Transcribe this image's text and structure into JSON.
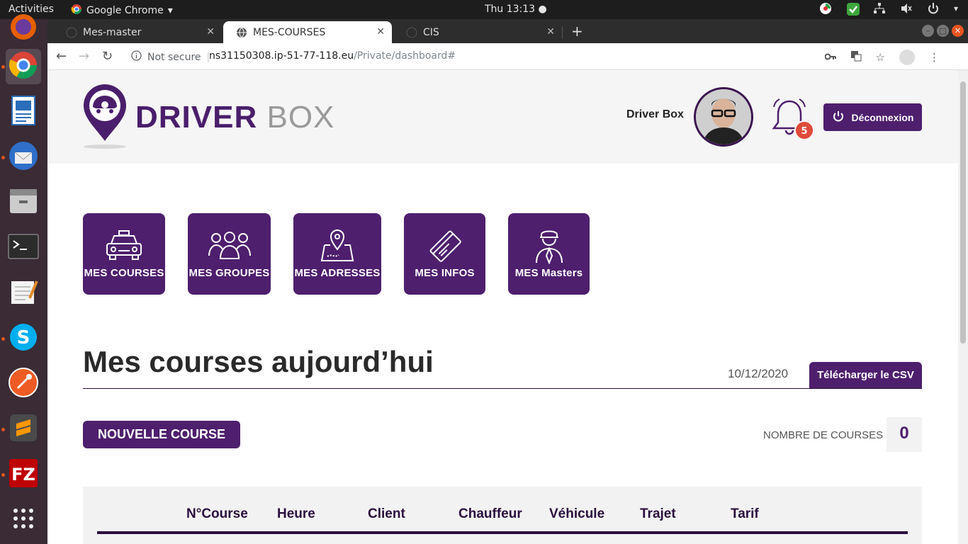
{
  "topbar": {
    "activities": "Activities",
    "app_name": "Google Chrome",
    "clock": "Thu 13:13 ●"
  },
  "dock": {
    "items": [
      "firefox-icon",
      "chrome-icon",
      "writer-icon",
      "thunderbird-icon",
      "files-icon",
      "terminal-icon",
      "text-editor-icon",
      "skype-icon",
      "postman-icon",
      "sublime-icon",
      "filezilla-icon",
      "app-grid-icon"
    ]
  },
  "browser": {
    "tabs": [
      {
        "label": "Mes-master"
      },
      {
        "label": "MES-COURSES"
      },
      {
        "label": "CIS"
      }
    ],
    "new_tab": "+",
    "security_label": "Not secure",
    "url_host": "ns31150308.ip-51-77-118.eu",
    "url_path": "/Private/dashboard#"
  },
  "header": {
    "logo_part1": "DRIVER",
    "logo_part2": "BOX",
    "user_name": "Driver Box",
    "notifications": "5",
    "logout_label": "Déconnexion"
  },
  "tiles": [
    {
      "label": "MES COURSES",
      "icon": "taxi-icon"
    },
    {
      "label": "MES GROUPES",
      "icon": "group-icon"
    },
    {
      "label": "MES ADRESSES",
      "icon": "map-pin-icon"
    },
    {
      "label": "MES INFOS",
      "icon": "card-icon"
    },
    {
      "label": "MES Masters",
      "icon": "driver-icon"
    }
  ],
  "section": {
    "title": "Mes courses aujourd’hui",
    "date": "10/12/2020",
    "csv_label": "Télécharger le CSV",
    "new_course_label": "NOUVELLE COURSE",
    "count_label": "NOMBRE DE COURSES :",
    "count_value": "0"
  },
  "table": {
    "columns": [
      "N°Course",
      "Heure",
      "Client",
      "Chauffeur",
      "Véhicule",
      "Trajet",
      "Tarif"
    ]
  },
  "colors": {
    "brand_purple": "#4e1f6d",
    "badge_red": "#e04a3a"
  }
}
